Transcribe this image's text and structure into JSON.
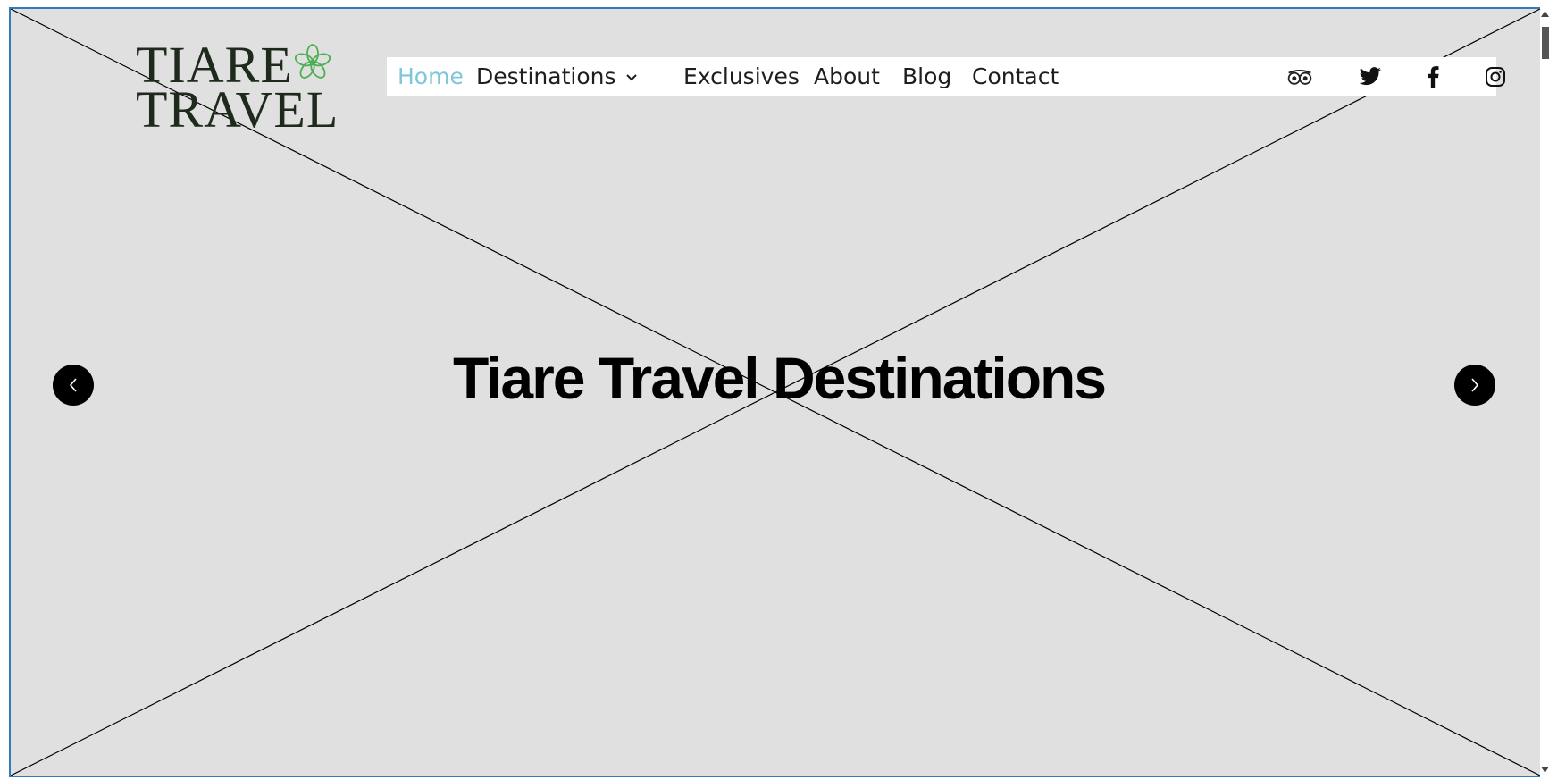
{
  "brand": {
    "line1": "TIARE",
    "line2": "TRAVEL",
    "logo_icon": "flower-icon",
    "logo_color": "#1d2a1c",
    "flower_color": "#4caf50"
  },
  "nav": {
    "items": [
      {
        "label": "Home",
        "active": true
      },
      {
        "label": "Destinations",
        "has_dropdown": true
      },
      {
        "label": "Exclusives"
      },
      {
        "label": "About"
      },
      {
        "label": "Blog"
      },
      {
        "label": "Contact"
      }
    ],
    "active_color": "#7fc6db",
    "social_icons": [
      "tripadvisor-icon",
      "twitter-icon",
      "facebook-icon",
      "instagram-icon"
    ]
  },
  "hero": {
    "title": "Tiare Travel Destinations",
    "prev_icon": "chevron-left-icon",
    "next_icon": "chevron-right-icon",
    "background_color": "#e0e0e0"
  }
}
